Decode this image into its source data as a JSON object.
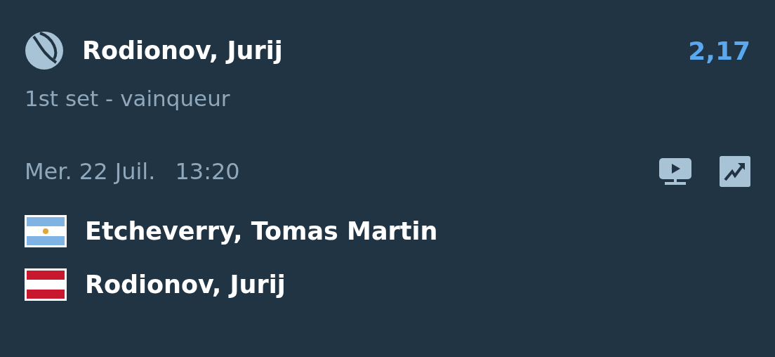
{
  "bet": {
    "selection": "Rodionov, Jurij",
    "odds": "2,17",
    "market": "1st set - vainqueur"
  },
  "match": {
    "date": "Mer. 22 Juil.",
    "time": "13:20",
    "players": [
      {
        "name": "Etcheverry, Tomas Martin",
        "kind": "argentina"
      },
      {
        "name": "Rodionov, Jurij",
        "kind": "austria"
      }
    ]
  }
}
